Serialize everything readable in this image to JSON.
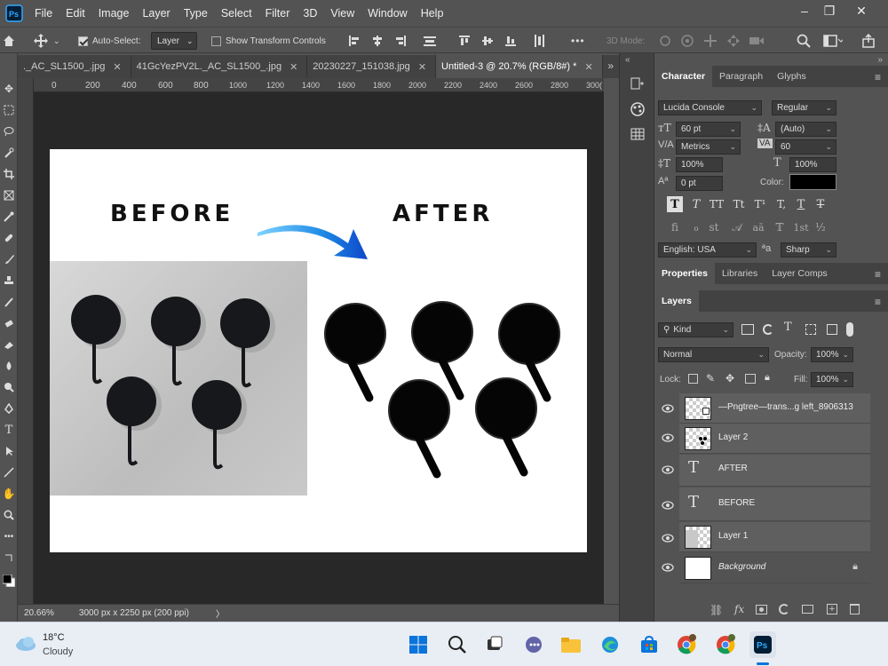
{
  "menubar": {
    "items": [
      "File",
      "Edit",
      "Image",
      "Layer",
      "Type",
      "Select",
      "Filter",
      "3D",
      "View",
      "Window",
      "Help"
    ]
  },
  "window_controls": {
    "minimize": "–",
    "restore": "❐",
    "close": "✕"
  },
  "options_bar": {
    "auto_select_label": "Auto-Select:",
    "auto_select_value": "Layer",
    "show_transform_label": "Show Transform Controls",
    "more_label": "•••",
    "mode_3d_label": "3D Mode:"
  },
  "tabs": [
    {
      "label": "._AC_SL1500_.jpg"
    },
    {
      "label": "41GcYezPV2L._AC_SL1500_.jpg"
    },
    {
      "label": "20230227_151038.jpg"
    },
    {
      "label": "Untitled-3 @ 20.7% (RGB/8#) *"
    }
  ],
  "ruler_labels": [
    "0",
    "200",
    "400",
    "600",
    "800",
    "1000",
    "1200",
    "1400",
    "1600",
    "1800",
    "2000",
    "2200",
    "2400",
    "2600",
    "2800",
    "300("
  ],
  "canvas": {
    "before_label": "BEFORE",
    "after_label": "AFTER"
  },
  "statusbar": {
    "zoom": "20.66%",
    "doc_info": "3000 px x 2250 px (200 ppi)",
    "arrow": "〉"
  },
  "character_panel": {
    "tabs": [
      "Character",
      "Paragraph",
      "Glyphs"
    ],
    "font_family": "Lucida Console",
    "font_style": "Regular",
    "font_size": "60 pt",
    "leading": "(Auto)",
    "kerning": "Metrics",
    "tracking": "60",
    "vertical_scale": "100%",
    "horizontal_scale": "100%",
    "baseline_shift": "0 pt",
    "color_label": "Color:",
    "type_buttons": [
      "T",
      "T",
      "TT",
      "Tt",
      "T¹",
      "T,",
      "T",
      "T"
    ],
    "opentype_buttons": [
      "fi",
      "ℴ",
      "st",
      "𝒜",
      "aā",
      "𝕋",
      "1st",
      "½"
    ],
    "language": "English: USA",
    "aa_label": "ªa",
    "antialias": "Sharp",
    "text_color": "#000000"
  },
  "properties_panel": {
    "tabs": [
      "Properties",
      "Libraries",
      "Layer Comps"
    ]
  },
  "layers_panel": {
    "tab": "Layers",
    "filter": "Kind",
    "blend_mode": "Normal",
    "opacity_label": "Opacity:",
    "opacity": "100%",
    "lock_label": "Lock:",
    "fill_label": "Fill:",
    "fill": "100%",
    "layers": [
      {
        "name": "—Pngtree—trans...g left_8906313"
      },
      {
        "name": "Layer 2"
      },
      {
        "name": "AFTER"
      },
      {
        "name": "BEFORE"
      },
      {
        "name": "Layer 1"
      },
      {
        "name": "Background"
      }
    ],
    "bottom_icons": [
      "link-icon",
      "fx-icon",
      "mask-icon",
      "adjustment-icon",
      "folder-icon",
      "new-layer-icon",
      "trash-icon"
    ]
  },
  "taskbar": {
    "temperature": "18°C",
    "weather": "Cloudy"
  },
  "colors": {
    "ui_bg": "#535353",
    "panel_dark": "#424242",
    "canvas_bg": "#282828",
    "arrow_blue": "#1e88e5",
    "accent_ps": "#31a8ff"
  }
}
